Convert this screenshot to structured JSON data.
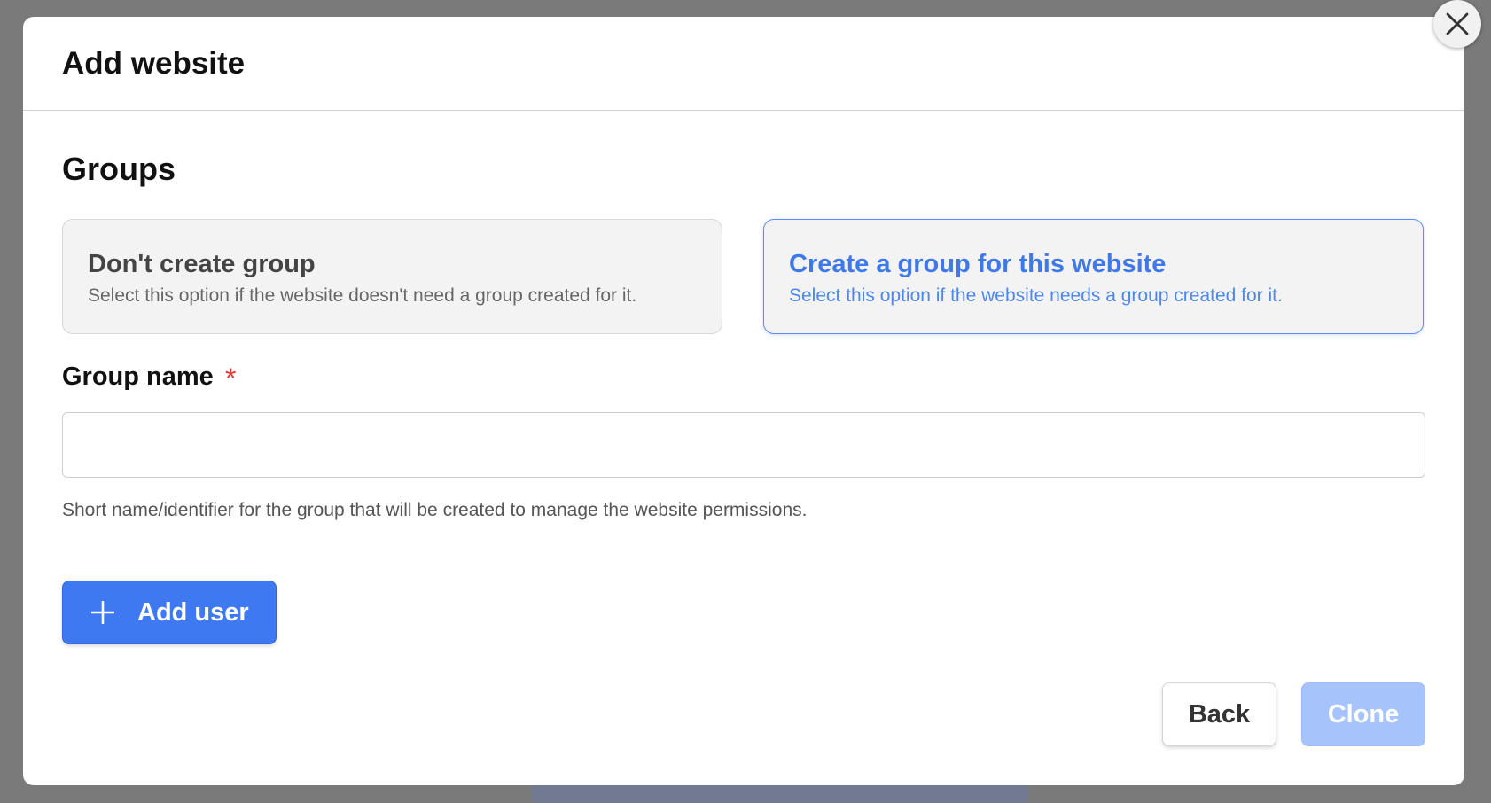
{
  "modal": {
    "title": "Add website",
    "close_icon": "close-icon"
  },
  "groups": {
    "section_title": "Groups",
    "options": [
      {
        "title": "Don't create group",
        "description": "Select this option if the website doesn't need a group created for it.",
        "selected": false
      },
      {
        "title": "Create a group for this website",
        "description": "Select this option if the website needs a group created for it.",
        "selected": true
      }
    ]
  },
  "group_name": {
    "label": "Group name",
    "required_mark": "*",
    "value": "",
    "placeholder": "",
    "help_text": "Short name/identifier for the group that will be created to manage the website permissions."
  },
  "actions": {
    "add_user_label": "Add user",
    "add_user_icon": "plus-icon",
    "back_label": "Back",
    "clone_label": "Clone",
    "clone_disabled": true
  },
  "colors": {
    "accent": "#3f79f2",
    "selected_text": "#3f79e8",
    "disabled_button": "#a7c3fb",
    "required": "#e53935",
    "backdrop": "#7a7a7a"
  }
}
